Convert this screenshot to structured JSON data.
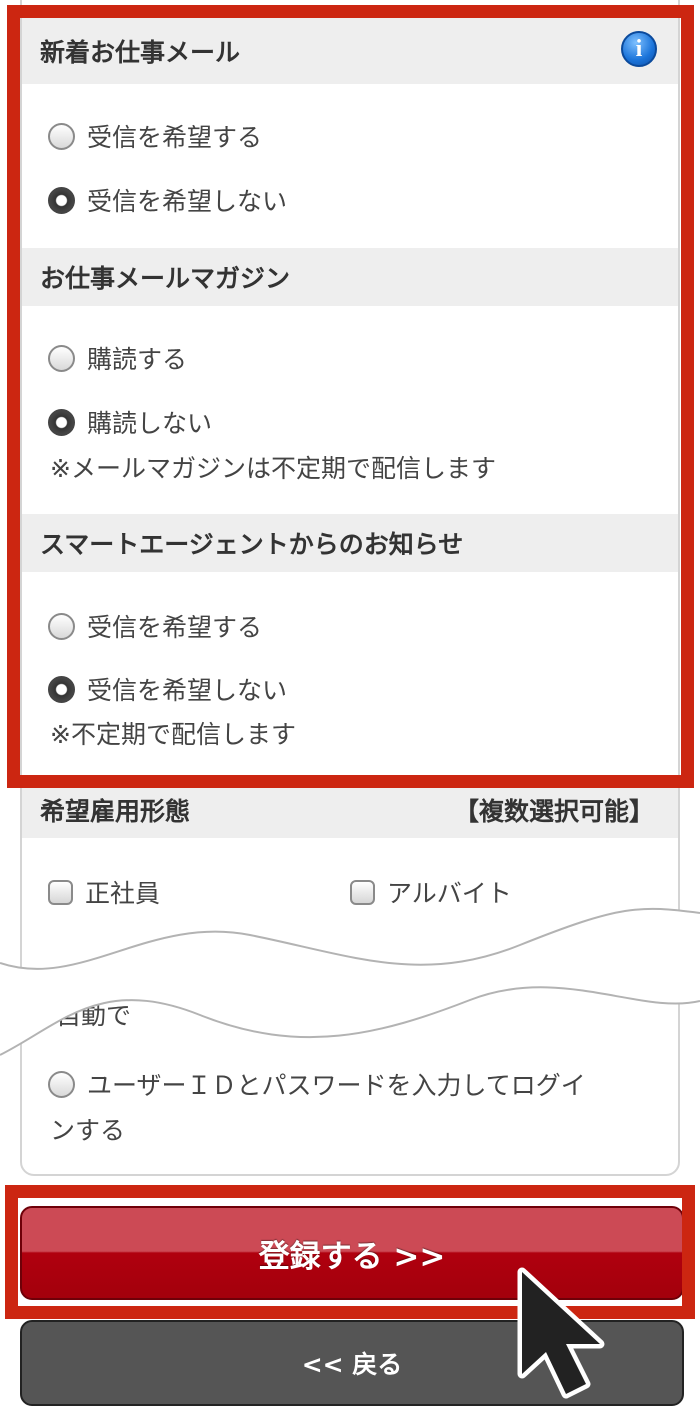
{
  "sections": [
    {
      "title": "新着お仕事メール",
      "options": [
        {
          "label": "受信を希望する",
          "selected": false
        },
        {
          "label": "受信を希望しない",
          "selected": true
        }
      ],
      "note": ""
    },
    {
      "title": "お仕事メールマガジン",
      "options": [
        {
          "label": "購読する",
          "selected": false
        },
        {
          "label": "購読しない",
          "selected": true
        }
      ],
      "note": "※メールマガジンは不定期で配信します"
    },
    {
      "title": "スマートエージェントからのお知らせ",
      "options": [
        {
          "label": "受信を希望する",
          "selected": false
        },
        {
          "label": "受信を希望しない",
          "selected": true
        }
      ],
      "note": "※不定期で配信します"
    }
  ],
  "employment": {
    "title": "希望雇用形態",
    "multi_label": "【複数選択可能】",
    "options": [
      "正社員",
      "アルバイト"
    ],
    "partial_text": "自動で"
  },
  "login_option": {
    "line1": "ユーザーＩＤとパスワードを入力してログイ",
    "line2": "ンする"
  },
  "buttons": {
    "register": "登録する >>",
    "back": "<< 戻る"
  },
  "colors": {
    "highlight": "#cc2611",
    "register_button": "#b3000f",
    "back_button": "#555555",
    "info_icon": "#1a73d9"
  },
  "icons": [
    "info-icon",
    "cursor-icon"
  ]
}
